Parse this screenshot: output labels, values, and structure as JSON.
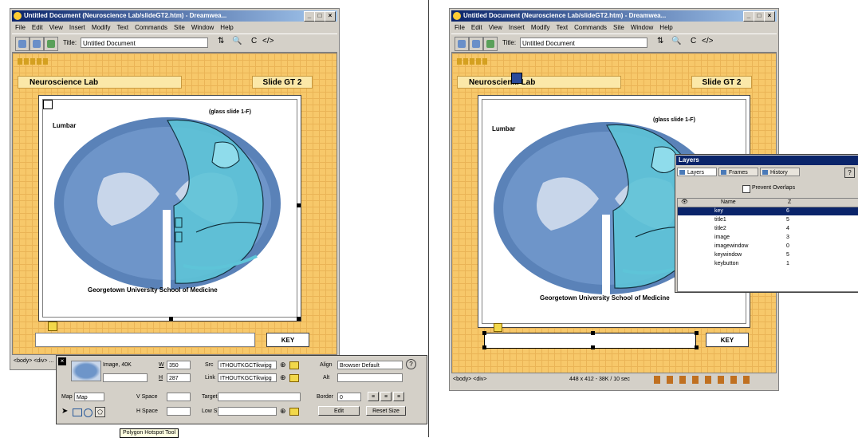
{
  "left": {
    "window_title": "Untitled Document (Neuroscience Lab/slideGT2.htm) - Dreamwea...",
    "menu": [
      "File",
      "Edit",
      "View",
      "Insert",
      "Modify",
      "Text",
      "Commands",
      "Site",
      "Window",
      "Help"
    ],
    "title_label": "Title:",
    "title_value": "Untitled Document",
    "page": {
      "lab_title": "Neuroscience Lab",
      "slide_label": "Slide GT 2",
      "lumbar": "Lumbar",
      "glass_slide": "(glass slide 1-F)",
      "school": "Georgetown University School of Medicine",
      "key_label": "KEY"
    },
    "status_tag": "<body> <div> ...",
    "properties": {
      "image_label": "Image, 40K",
      "w_label": "W",
      "w_value": "350",
      "h_label": "H",
      "h_value": "287",
      "src_label": "Src",
      "src_value": "ITHOUTKGCTikwipg",
      "link_label": "Link",
      "link_value": "ITHOUTKGCTikwipg",
      "align_label": "Align",
      "align_value": "Browser Default",
      "alt_label": "Alt",
      "map_label": "Map",
      "map_value": "Map",
      "vspace_label": "V Space",
      "hspace_label": "H Space",
      "target_label": "Target",
      "lowsrc_label": "Low Src",
      "border_label": "Border",
      "border_value": "0",
      "edit_button": "Edit",
      "reset_button": "Reset Size",
      "tooltip": "Polygon Hotspot Tool"
    }
  },
  "right": {
    "window_title": "Untitled Document (Neuroscience Lab/slideGT2.htm) - Dreamwea...",
    "menu": [
      "File",
      "Edit",
      "View",
      "Insert",
      "Modify",
      "Text",
      "Commands",
      "Site",
      "Window",
      "Help"
    ],
    "title_label": "Title:",
    "title_value": "Untitled Document",
    "page": {
      "lab_title": "Neuroscien... Lab",
      "slide_label": "Slide GT 2",
      "lumbar": "Lumbar",
      "glass_slide": "(glass slide 1-F)",
      "school": "Georgetown University School of Medicine",
      "key_label": "KEY"
    },
    "status_tag": "<body> <div>",
    "status_right": "448 x 412 - 38K / 10 sec",
    "layers_panel": {
      "title": "Layers",
      "tabs": [
        "Layers",
        "Frames",
        "History"
      ],
      "help": "?",
      "prevent_overlaps": "Prevent Overlaps",
      "col_name": "Name",
      "col_z": "Z",
      "rows": [
        {
          "name": "key",
          "z": "6",
          "selected": true
        },
        {
          "name": "title1",
          "z": "5",
          "selected": false
        },
        {
          "name": "title2",
          "z": "4",
          "selected": false
        },
        {
          "name": "image",
          "z": "3",
          "selected": false
        },
        {
          "name": "imagewindow",
          "z": "0",
          "selected": false
        },
        {
          "name": "keywindow",
          "z": "5",
          "selected": false
        },
        {
          "name": "keybutton",
          "z": "1",
          "selected": false
        }
      ]
    }
  }
}
